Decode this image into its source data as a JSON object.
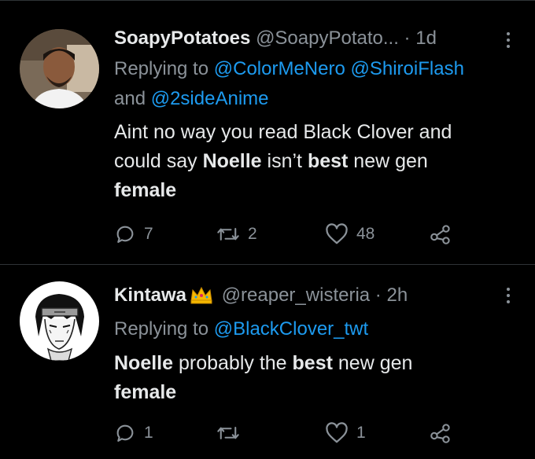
{
  "colors": {
    "background": "#000000",
    "text": "#e7e9ea",
    "muted": "#8b9299",
    "link": "#1d9bf0",
    "divider": "#2f3336",
    "crown": "#f5b800"
  },
  "tweets": [
    {
      "display_name": "SoapyPotatoes",
      "handle": "@SoapyPotato...",
      "separator": "·",
      "time": "1d",
      "has_crown": false,
      "replying_prefix": "Replying to",
      "mentions": [
        "@ColorMeNero",
        "@ShiroiFlash",
        "@2sideAnime"
      ],
      "mention_joiner": "and",
      "body_segments": [
        {
          "text": "Aint no way you read Black Clover and could say ",
          "bold": false
        },
        {
          "text": "Noelle",
          "bold": true
        },
        {
          "text": " isn’t ",
          "bold": false
        },
        {
          "text": "best",
          "bold": true
        },
        {
          "text": " new gen ",
          "bold": false
        },
        {
          "text": "female",
          "bold": true
        }
      ],
      "actions": {
        "reply_count": "7",
        "retweet_count": "2",
        "like_count": "48",
        "reply_icon": "reply-icon",
        "retweet_icon": "retweet-icon",
        "like_icon": "heart-icon",
        "share_icon": "share-icon"
      }
    },
    {
      "display_name": "Kintawa",
      "handle": "@reaper_wisteria",
      "separator": "·",
      "time": "2h",
      "has_crown": true,
      "crown_icon": "crown-icon",
      "replying_prefix": "Replying to",
      "mentions": [
        "@BlackClover_twt"
      ],
      "body_segments": [
        {
          "text": "Noelle",
          "bold": true
        },
        {
          "text": " probably the ",
          "bold": false
        },
        {
          "text": "best",
          "bold": true
        },
        {
          "text": " new gen ",
          "bold": false
        },
        {
          "text": "female",
          "bold": true
        }
      ],
      "actions": {
        "reply_count": "1",
        "retweet_count": "",
        "like_count": "1",
        "reply_icon": "reply-icon",
        "retweet_icon": "retweet-icon",
        "like_icon": "heart-icon",
        "share_icon": "share-icon"
      }
    }
  ]
}
